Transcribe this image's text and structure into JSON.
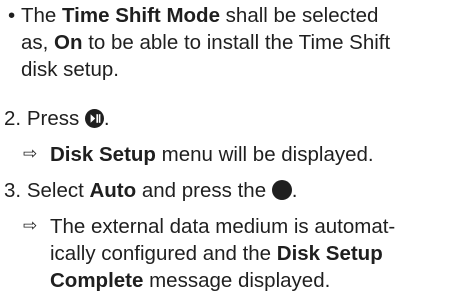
{
  "bullet": {
    "mark": "•",
    "line1_pre": "The ",
    "line1_bold": "Time Shift Mode",
    "line1_post": " shall be selected",
    "line2_pre": "as, ",
    "line2_bold": "On",
    "line2_post": " to be able to install the Time Shift",
    "line3": "disk setup."
  },
  "step2": {
    "number": "2.",
    "text_pre": "Press ",
    "icon": "play-pause-icon",
    "text_post": "."
  },
  "result2": {
    "arrow": "⇨",
    "bold": "Disk Setup",
    "text_post": " menu will be displayed."
  },
  "step3": {
    "number": "3.",
    "text_pre": "Select ",
    "bold": "Auto",
    "text_mid": " and press the ",
    "icon": "ok-button-icon",
    "text_post": "."
  },
  "result3": {
    "arrow": "⇨",
    "line1": "The external data medium is automat-",
    "line2_pre": "ically configured and the ",
    "line2_bold": "Disk Setup",
    "line3_bold": "Complete",
    "line3_post": " message displayed."
  }
}
